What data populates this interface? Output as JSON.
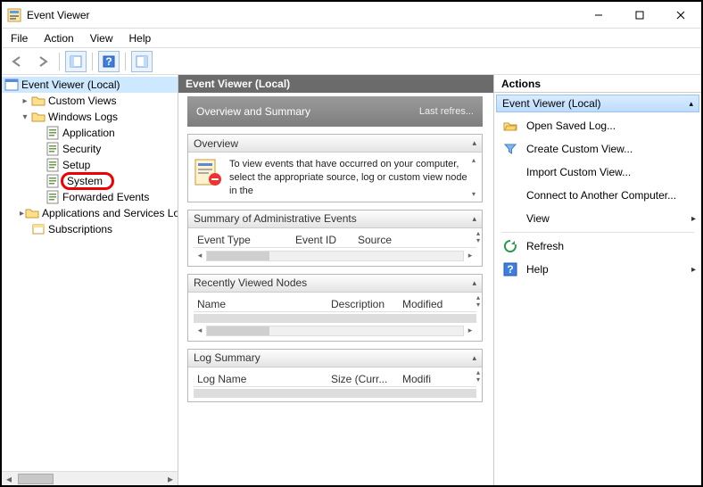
{
  "window": {
    "title": "Event Viewer"
  },
  "menus": [
    "File",
    "Action",
    "View",
    "Help"
  ],
  "tree": {
    "root": "Event Viewer (Local)",
    "items": [
      {
        "label": "Custom Views",
        "expand": "▸",
        "indent": 1
      },
      {
        "label": "Windows Logs",
        "expand": "▾",
        "indent": 1
      },
      {
        "label": "Application",
        "indent": 2
      },
      {
        "label": "Security",
        "indent": 2
      },
      {
        "label": "Setup",
        "indent": 2
      },
      {
        "label": "System",
        "indent": 2,
        "highlight": true
      },
      {
        "label": "Forwarded Events",
        "indent": 2
      },
      {
        "label": "Applications and Services Lo",
        "expand": "▸",
        "indent": 1
      },
      {
        "label": "Subscriptions",
        "indent": 1
      }
    ]
  },
  "center": {
    "title": "Event Viewer (Local)",
    "summary_title": "Overview and Summary",
    "refresh": "Last refres...",
    "overview": {
      "header": "Overview",
      "text": "To view events that have occurred on your computer, select the appropriate source, log or custom view node in the"
    },
    "admin": {
      "header": "Summary of Administrative Events",
      "cols": [
        "Event Type",
        "Event ID",
        "Source"
      ]
    },
    "recent": {
      "header": "Recently Viewed Nodes",
      "cols": [
        "Name",
        "Description",
        "Modified"
      ]
    },
    "logsum": {
      "header": "Log Summary",
      "cols": [
        "Log Name",
        "Size (Curr...",
        "Modifi"
      ]
    }
  },
  "actions": {
    "header": "Actions",
    "sub": "Event Viewer (Local)",
    "items": [
      {
        "icon": "folder-open-icon",
        "label": "Open Saved Log..."
      },
      {
        "icon": "filter-icon",
        "label": "Create Custom View..."
      },
      {
        "icon": "blank-icon",
        "label": "Import Custom View..."
      },
      {
        "icon": "blank-icon",
        "label": "Connect to Another Computer..."
      },
      {
        "icon": "blank-icon",
        "label": "View",
        "more": "▸"
      },
      {
        "sep": true
      },
      {
        "icon": "refresh-icon",
        "label": "Refresh"
      },
      {
        "icon": "help-icon",
        "label": "Help",
        "more": "▸"
      }
    ]
  }
}
